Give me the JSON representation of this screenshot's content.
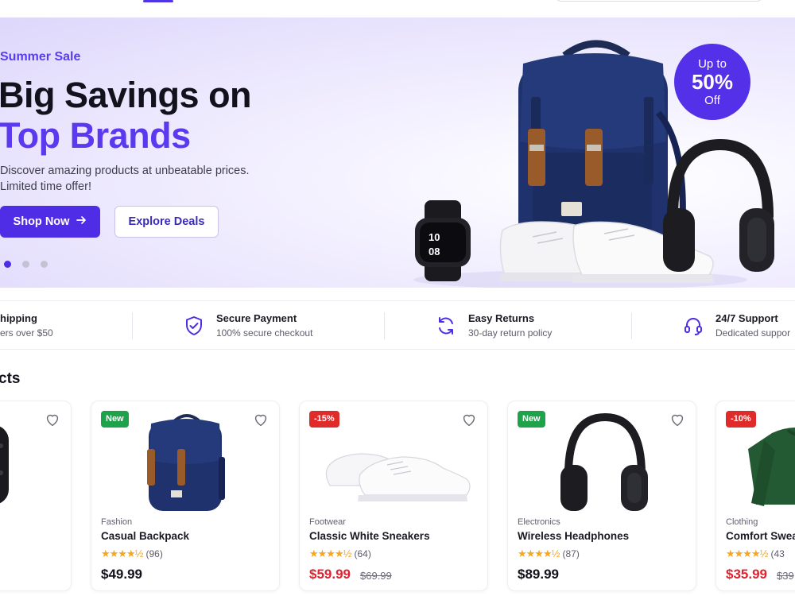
{
  "hero": {
    "eyebrow": "Summer Sale",
    "title_line1": "Big Savings on",
    "title_line2": "Top Brands",
    "description": "Discover amazing products at unbeatable prices. Limited time offer!",
    "primary_button": "Shop Now",
    "secondary_button": "Explore Deals",
    "badge_top": "Up to",
    "badge_value": "50%",
    "badge_bottom": "Off",
    "watch_time": "10 08",
    "carousel_slides": 3,
    "active_slide": 1
  },
  "features": [
    {
      "title": "hipping",
      "subtitle": "ers over $50",
      "icon": "truck-icon"
    },
    {
      "title": "Secure Payment",
      "subtitle": "100% secure checkout",
      "icon": "shield-check-icon"
    },
    {
      "title": "Easy Returns",
      "subtitle": "30-day return policy",
      "icon": "refresh-icon"
    },
    {
      "title": "24/7 Support",
      "subtitle": "Dedicated suppor",
      "icon": "headset-icon"
    }
  ],
  "section": {
    "title": "cts"
  },
  "products": [
    {
      "badge": "",
      "category": "",
      "name": "",
      "rating_count": "",
      "price": "",
      "old_price": ""
    },
    {
      "badge": "New",
      "category": "Fashion",
      "name": "Casual Backpack",
      "rating_count": "(96)",
      "price": "$49.99",
      "old_price": ""
    },
    {
      "badge": "-15%",
      "category": "Footwear",
      "name": "Classic White Sneakers",
      "rating_count": "(64)",
      "price": "$59.99",
      "old_price": "$69.99"
    },
    {
      "badge": "New",
      "category": "Electronics",
      "name": "Wireless Headphones",
      "rating_count": "(87)",
      "price": "$89.99",
      "old_price": ""
    },
    {
      "badge": "-10%",
      "category": "Clothing",
      "name": "Comfort Swea",
      "rating_count": "(43",
      "price": "$35.99",
      "old_price": "$39"
    }
  ],
  "colors": {
    "accent": "#5430e8",
    "new_badge": "#1fa34a",
    "sale_badge": "#e02b2b",
    "star": "#f5a623"
  }
}
